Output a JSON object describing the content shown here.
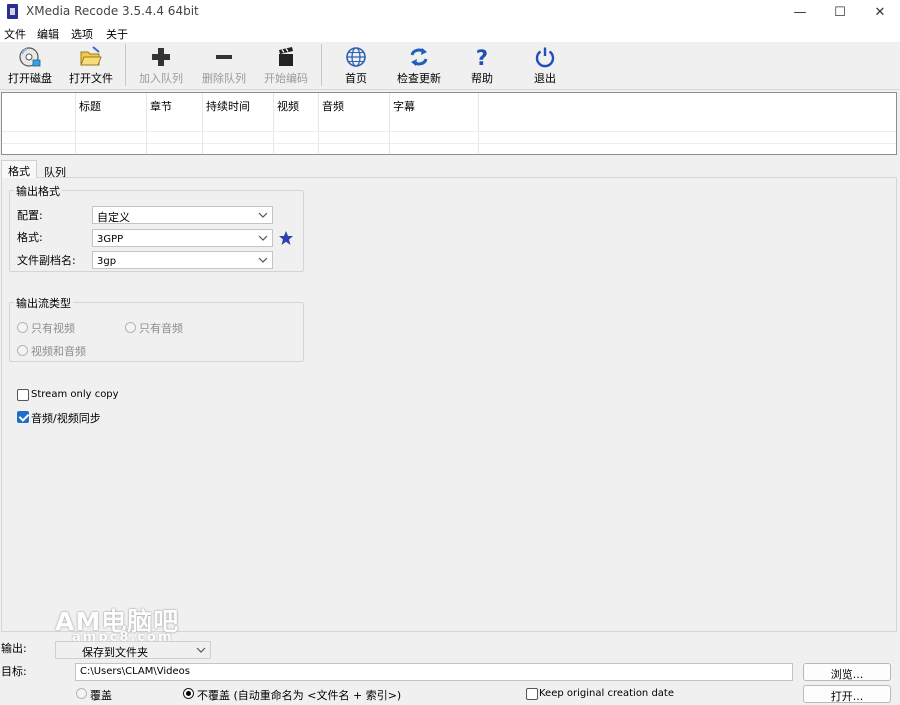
{
  "window": {
    "title": "XMedia Recode 3.5.4.4 64bit",
    "minimize": "—",
    "maximize": "☐",
    "close": "✕"
  },
  "menu": [
    "文件",
    "编辑",
    "选项",
    "关于"
  ],
  "toolbar": {
    "open_disc": "打开磁盘",
    "open_file": "打开文件",
    "add_queue": "加入队列",
    "remove_queue": "删除队列",
    "start_encode": "开始编码",
    "home": "首页",
    "check_update": "检查更新",
    "help": "帮助",
    "exit": "退出"
  },
  "file_table": {
    "columns": [
      "",
      "标题",
      "章节",
      "持续时间",
      "视频",
      "音频",
      "字幕"
    ]
  },
  "tabs": {
    "format": "格式",
    "queue": "队列"
  },
  "output_format": {
    "group_title": "输出格式",
    "profile_label": "配置:",
    "profile_value": "自定义",
    "format_label": "格式:",
    "format_value": "3GPP",
    "extension_label": "文件副档名:",
    "extension_value": "3gp"
  },
  "stream_type": {
    "group_title": "输出流类型",
    "video_only": "只有视频",
    "audio_only": "只有音频",
    "video_audio": "视频和音频"
  },
  "options": {
    "stream_copy": "Stream only copy",
    "stream_copy_checked": false,
    "av_sync": "音频/视频同步",
    "av_sync_checked": true
  },
  "output": {
    "output_label": "输出:",
    "output_value": "保存到文件夹",
    "target_label": "目标:",
    "target_path": "C:\\Users\\CLAM\\Videos",
    "browse_button": "浏览...",
    "open_button": "打开...",
    "overwrite": "覆盖",
    "no_overwrite": "不覆盖 (自动重命名为 <文件名 + 索引>)",
    "keep_date": "Keep original creation date"
  },
  "watermark": {
    "main": "AM电脑吧",
    "sub": "ampc8.com"
  },
  "colors": {
    "accent": "#1f6fc9",
    "star": "#2f3fb3",
    "globe": "#2a62b8"
  }
}
